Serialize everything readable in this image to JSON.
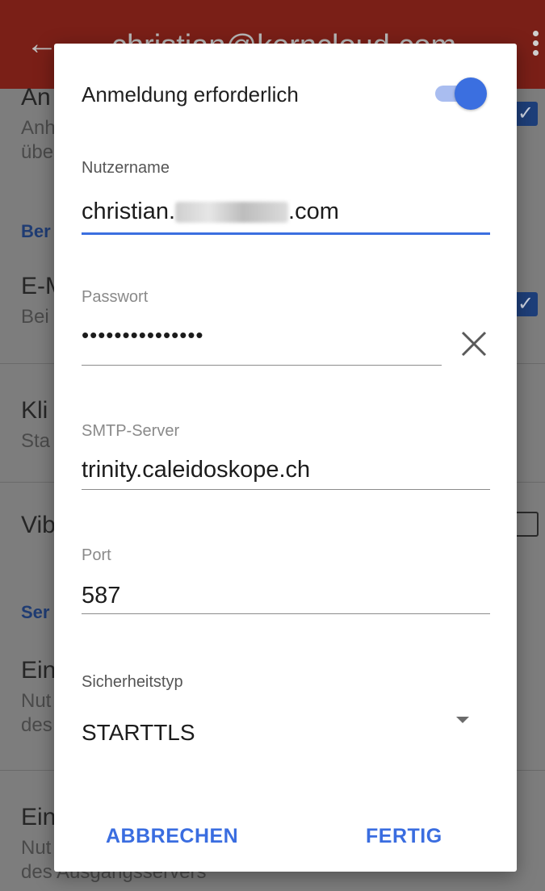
{
  "background": {
    "appbar_title": "christian@kerncloud.com",
    "items": [
      {
        "title": "An",
        "sub1": "Anh",
        "sub2": "übe"
      },
      {
        "title": "E-M",
        "sub1": "Bei"
      },
      {
        "title": "Kli",
        "sub1": "Sta"
      },
      {
        "title": "Vib"
      },
      {
        "title": "Ein",
        "sub1": "Nut",
        "sub2": "des"
      },
      {
        "title": "Ein",
        "sub1": "Nut",
        "sub2": "des Ausgangsservers"
      }
    ],
    "sections": [
      "Ber",
      "Ser"
    ]
  },
  "dialog": {
    "auth_label": "Anmeldung erforderlich",
    "auth_enabled": true,
    "username_label": "Nutzername",
    "username_prefix": "christian.",
    "username_suffix": ".com",
    "password_label": "Passwort",
    "password_value": "•••••••••••••••",
    "smtp_label": "SMTP-Server",
    "smtp_value": "trinity.caleidoskope.ch",
    "port_label": "Port",
    "port_value": "587",
    "security_label": "Sicherheitstyp",
    "security_value": "STARTTLS",
    "cancel_label": "ABBRECHEN",
    "done_label": "FERTIG"
  },
  "colors": {
    "accent": "#3b6fe0",
    "appbar": "#7a1f17"
  }
}
